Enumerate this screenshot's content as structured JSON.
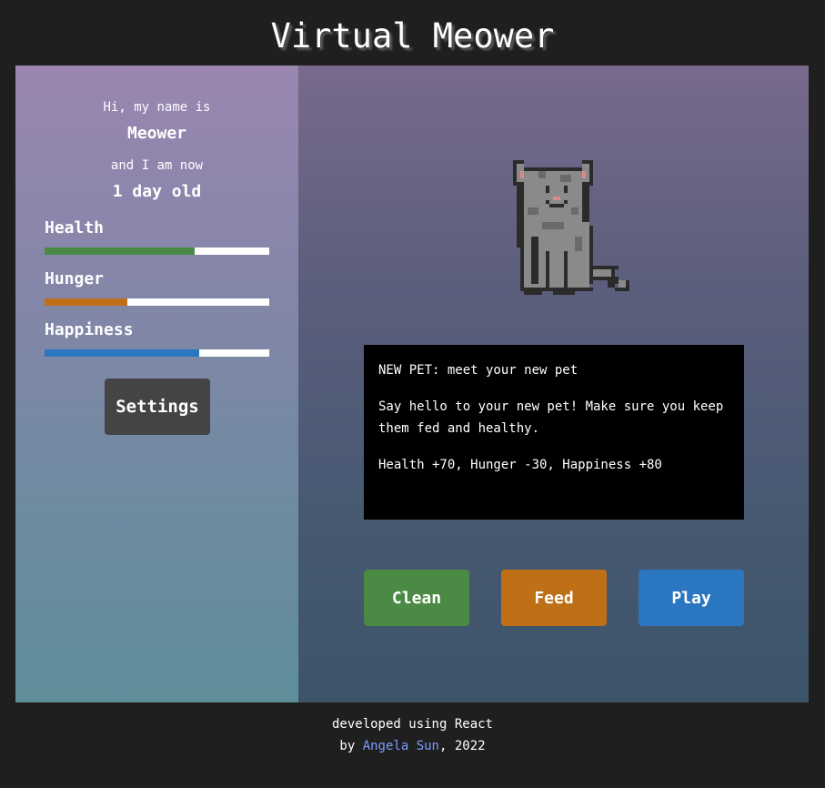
{
  "app": {
    "title": "Virtual Meower"
  },
  "pet": {
    "intro_name": "Hi, my name is",
    "name": "Meower",
    "intro_age": "and I am now",
    "age": "1 day old"
  },
  "stats": [
    {
      "label": "Health",
      "value": 0.67,
      "color": "#4a8a45"
    },
    {
      "label": "Hunger",
      "value": 0.37,
      "color": "#bf7016"
    },
    {
      "label": "Happiness",
      "value": 0.69,
      "color": "#2b76c0"
    }
  ],
  "settings": {
    "label": "Settings"
  },
  "message": {
    "title": "NEW PET: meet your new pet",
    "body": "Say hello to your new pet! Make sure you keep them fed and healthy.",
    "effects": "Health +70, Hunger -30, Happiness +80"
  },
  "actions": [
    {
      "label": "Clean",
      "color": "#4a8a45"
    },
    {
      "label": "Feed",
      "color": "#bf7016"
    },
    {
      "label": "Play",
      "color": "#2b76c0"
    }
  ],
  "footer": {
    "line1": "developed using React",
    "by": "by",
    "author": "Angela Sun",
    "year": ", 2022"
  },
  "icons": {
    "pet": "pixel-cat-icon"
  }
}
